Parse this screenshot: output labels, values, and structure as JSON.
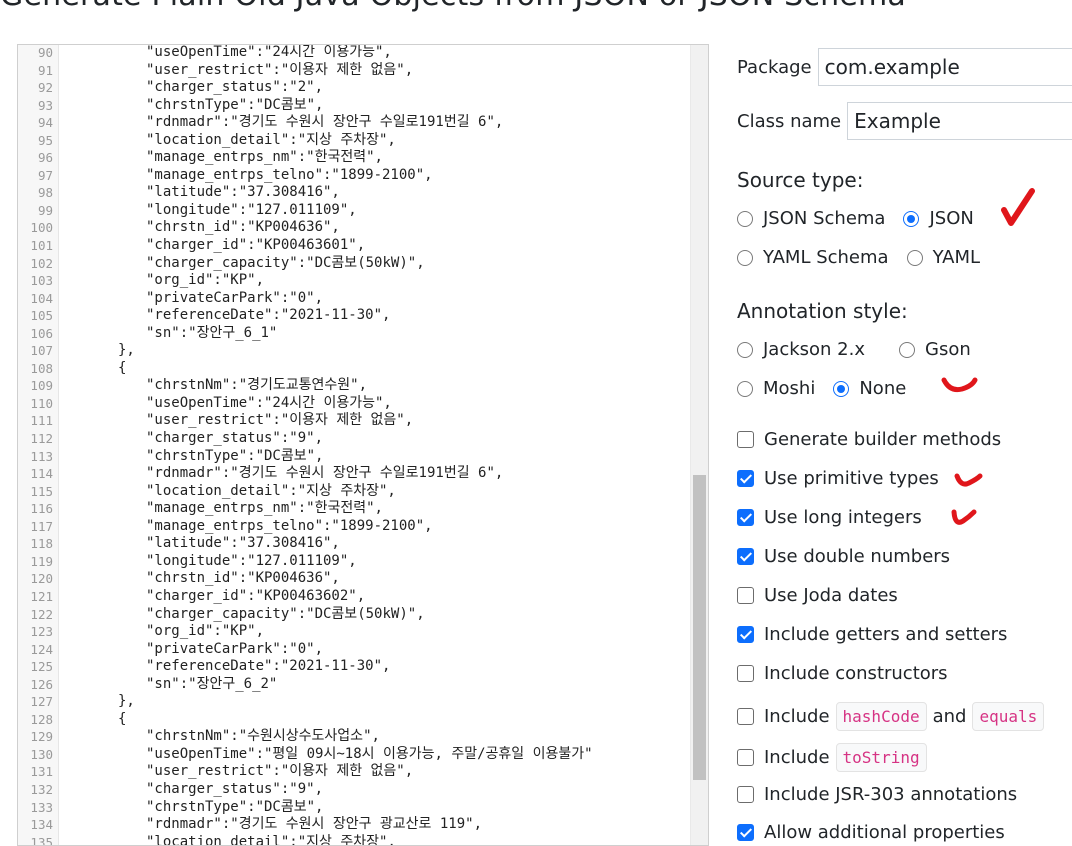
{
  "page": {
    "title": "Generate Plain Old Java Objects from JSON or JSON Schema"
  },
  "editor": {
    "lines": [
      {
        "n": "90",
        "t": "\"useOpenTime\":\"24시간 이용가능\","
      },
      {
        "n": "91",
        "t": "\"user_restrict\":\"이용자 제한 없음\","
      },
      {
        "n": "92",
        "t": "\"charger_status\":\"2\","
      },
      {
        "n": "93",
        "t": "\"chrstnType\":\"DC콤보\","
      },
      {
        "n": "94",
        "t": "\"rdnmadr\":\"경기도 수원시 장안구 수일로191번길 6\","
      },
      {
        "n": "95",
        "t": "\"location_detail\":\"지상 주차장\","
      },
      {
        "n": "96",
        "t": "\"manage_entrps_nm\":\"한국전력\","
      },
      {
        "n": "97",
        "t": "\"manage_entrps_telno\":\"1899-2100\","
      },
      {
        "n": "98",
        "t": "\"latitude\":\"37.308416\","
      },
      {
        "n": "99",
        "t": "\"longitude\":\"127.011109\","
      },
      {
        "n": "100",
        "t": "\"chrstn_id\":\"KP004636\","
      },
      {
        "n": "101",
        "t": "\"charger_id\":\"KP00463601\","
      },
      {
        "n": "102",
        "t": "\"charger_capacity\":\"DC콤보(50kW)\","
      },
      {
        "n": "103",
        "t": "\"org_id\":\"KP\","
      },
      {
        "n": "104",
        "t": "\"privateCarPark\":\"0\","
      },
      {
        "n": "105",
        "t": "\"referenceDate\":\"2021-11-30\","
      },
      {
        "n": "106",
        "t": "\"sn\":\"장안구_6_1\""
      },
      {
        "n": "107",
        "t": "},"
      },
      {
        "n": "108",
        "t": "{"
      },
      {
        "n": "109",
        "t": "\"chrstnNm\":\"경기도교통연수원\","
      },
      {
        "n": "110",
        "t": "\"useOpenTime\":\"24시간 이용가능\","
      },
      {
        "n": "111",
        "t": "\"user_restrict\":\"이용자 제한 없음\","
      },
      {
        "n": "112",
        "t": "\"charger_status\":\"9\","
      },
      {
        "n": "113",
        "t": "\"chrstnType\":\"DC콤보\","
      },
      {
        "n": "114",
        "t": "\"rdnmadr\":\"경기도 수원시 장안구 수일로191번길 6\","
      },
      {
        "n": "115",
        "t": "\"location_detail\":\"지상 주차장\","
      },
      {
        "n": "116",
        "t": "\"manage_entrps_nm\":\"한국전력\","
      },
      {
        "n": "117",
        "t": "\"manage_entrps_telno\":\"1899-2100\","
      },
      {
        "n": "118",
        "t": "\"latitude\":\"37.308416\","
      },
      {
        "n": "119",
        "t": "\"longitude\":\"127.011109\","
      },
      {
        "n": "120",
        "t": "\"chrstn_id\":\"KP004636\","
      },
      {
        "n": "121",
        "t": "\"charger_id\":\"KP00463602\","
      },
      {
        "n": "122",
        "t": "\"charger_capacity\":\"DC콤보(50kW)\","
      },
      {
        "n": "123",
        "t": "\"org_id\":\"KP\","
      },
      {
        "n": "124",
        "t": "\"privateCarPark\":\"0\","
      },
      {
        "n": "125",
        "t": "\"referenceDate\":\"2021-11-30\","
      },
      {
        "n": "126",
        "t": "\"sn\":\"장안구_6_2\""
      },
      {
        "n": "127",
        "t": "},"
      },
      {
        "n": "128",
        "t": "{"
      },
      {
        "n": "129",
        "t": "\"chrstnNm\":\"수원시상수도사업소\","
      },
      {
        "n": "130",
        "t": "\"useOpenTime\":\"평일 09시~18시 이용가능, 주말/공휴일 이용불가\""
      },
      {
        "n": "131",
        "t": "\"user_restrict\":\"이용자 제한 없음\","
      },
      {
        "n": "132",
        "t": "\"charger_status\":\"9\","
      },
      {
        "n": "133",
        "t": "\"chrstnType\":\"DC콤보\","
      },
      {
        "n": "134",
        "t": "\"rdnmadr\":\"경기도 수원시 장안구 광교산로 119\","
      },
      {
        "n": "135",
        "t": "\"location_detail\":\"지상 주차장\","
      }
    ]
  },
  "options": {
    "package_label": "Package",
    "package_value": "com.example",
    "classname_label": "Class name",
    "classname_value": "Example",
    "source_type_title": "Source type:",
    "source_types": [
      {
        "label": "JSON Schema",
        "checked": false
      },
      {
        "label": "JSON",
        "checked": true
      },
      {
        "label": "YAML Schema",
        "checked": false
      },
      {
        "label": "YAML",
        "checked": false
      }
    ],
    "annotation_title": "Annotation style:",
    "annotation_styles": [
      {
        "label": "Jackson 2.x",
        "checked": false
      },
      {
        "label": "Gson",
        "checked": false
      },
      {
        "label": "Moshi",
        "checked": false
      },
      {
        "label": "None",
        "checked": true
      }
    ],
    "checkboxes": [
      {
        "label": "Generate builder methods",
        "checked": false
      },
      {
        "label": "Use primitive types",
        "checked": true
      },
      {
        "label": "Use long integers",
        "checked": true
      },
      {
        "label": "Use double numbers",
        "checked": true
      },
      {
        "label": "Use Joda dates",
        "checked": false
      },
      {
        "label": "Include getters and setters",
        "checked": true
      },
      {
        "label": "Include constructors",
        "checked": false
      },
      {
        "label": "Include",
        "code1": "hashCode",
        "mid": "and",
        "code2": "equals",
        "checked": false
      },
      {
        "label": "Include",
        "code1": "toString",
        "checked": false
      },
      {
        "label": "Include JSR-303 annotations",
        "checked": false
      },
      {
        "label": "Allow additional properties",
        "checked": true
      }
    ]
  },
  "colors": {
    "accent": "#0d6efd",
    "annotation_mark": "#e0161b",
    "code_chip": "#d63384"
  }
}
